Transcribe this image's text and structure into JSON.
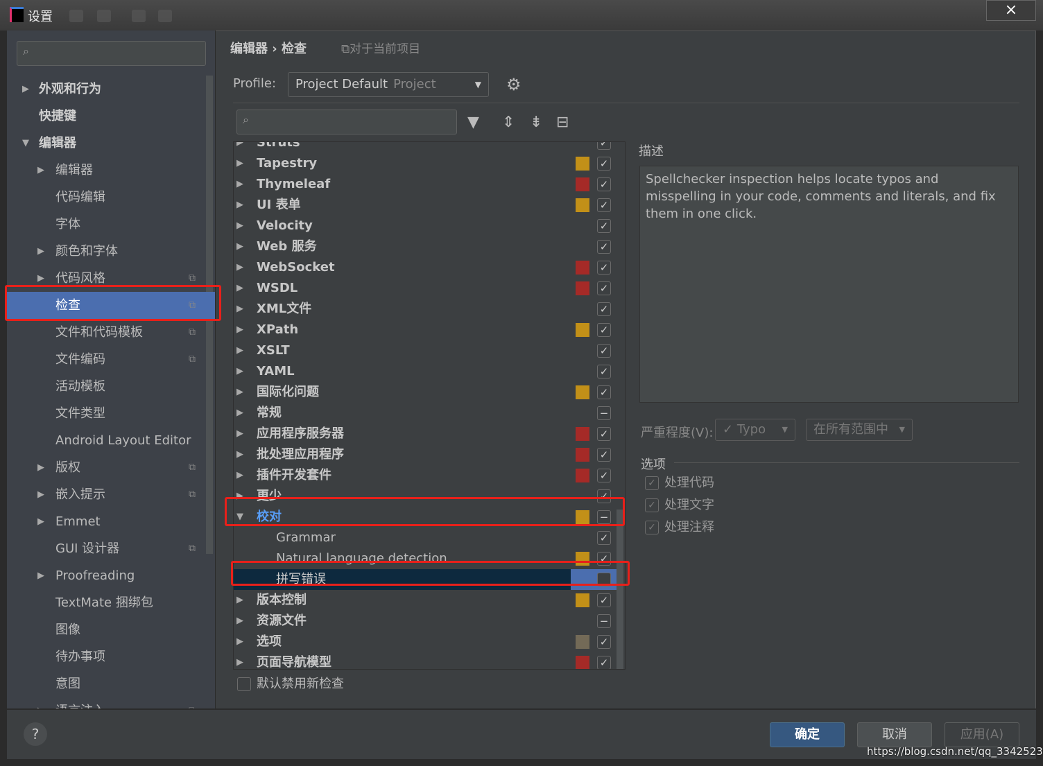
{
  "window": {
    "title": "设置",
    "close_icon": "×"
  },
  "sidebar": {
    "search_placeholder": "",
    "items": [
      {
        "label": "外观和行为",
        "arrow": "▶",
        "level": 0,
        "bold": true
      },
      {
        "label": "快捷键",
        "arrow": "",
        "level": 0,
        "bold": true
      },
      {
        "label": "编辑器",
        "arrow": "▼",
        "level": 0,
        "bold": true
      },
      {
        "label": "编辑器",
        "arrow": "▶",
        "level": 1
      },
      {
        "label": "代码编辑",
        "arrow": "",
        "level": 1
      },
      {
        "label": "字体",
        "arrow": "",
        "level": 1
      },
      {
        "label": "颜色和字体",
        "arrow": "▶",
        "level": 1
      },
      {
        "label": "代码风格",
        "arrow": "▶",
        "level": 1,
        "copy": true
      },
      {
        "label": "检查",
        "arrow": "",
        "level": 1,
        "copy": true,
        "selected": true
      },
      {
        "label": "文件和代码模板",
        "arrow": "",
        "level": 1,
        "copy": true
      },
      {
        "label": "文件编码",
        "arrow": "",
        "level": 1,
        "copy": true
      },
      {
        "label": "活动模板",
        "arrow": "",
        "level": 1
      },
      {
        "label": "文件类型",
        "arrow": "",
        "level": 1
      },
      {
        "label": "Android Layout Editor",
        "arrow": "",
        "level": 1
      },
      {
        "label": "版权",
        "arrow": "▶",
        "level": 1,
        "copy": true
      },
      {
        "label": "嵌入提示",
        "arrow": "▶",
        "level": 1,
        "copy": true
      },
      {
        "label": "Emmet",
        "arrow": "▶",
        "level": 1
      },
      {
        "label": "GUI 设计器",
        "arrow": "",
        "level": 1,
        "copy": true
      },
      {
        "label": "Proofreading",
        "arrow": "▶",
        "level": 1
      },
      {
        "label": "TextMate 捆绑包",
        "arrow": "",
        "level": 1
      },
      {
        "label": "图像",
        "arrow": "",
        "level": 1
      },
      {
        "label": "待办事项",
        "arrow": "",
        "level": 1
      },
      {
        "label": "意图",
        "arrow": "",
        "level": 1
      },
      {
        "label": "语言注入",
        "arrow": "▶",
        "level": 1,
        "copy": true
      }
    ]
  },
  "main": {
    "breadcrumb": "编辑器 › 检查",
    "scope_note": "对于当前项目",
    "profile_label": "Profile:",
    "profile_value": "Project Default",
    "profile_scope": "Project",
    "tree": [
      {
        "label": "Struts",
        "arrow": "▶",
        "sev": "",
        "state": "check"
      },
      {
        "label": "Tapestry",
        "arrow": "▶",
        "sev": "#c29018",
        "state": "check"
      },
      {
        "label": "Thymeleaf",
        "arrow": "▶",
        "sev": "#a52a27",
        "state": "check"
      },
      {
        "label": "UI 表单",
        "arrow": "▶",
        "sev": "#c29018",
        "state": "check"
      },
      {
        "label": "Velocity",
        "arrow": "▶",
        "sev": "",
        "state": "check"
      },
      {
        "label": "Web 服务",
        "arrow": "▶",
        "sev": "",
        "state": "check"
      },
      {
        "label": "WebSocket",
        "arrow": "▶",
        "sev": "#a52a27",
        "state": "check"
      },
      {
        "label": "WSDL",
        "arrow": "▶",
        "sev": "#a52a27",
        "state": "check"
      },
      {
        "label": "XML文件",
        "arrow": "▶",
        "sev": "",
        "state": "check"
      },
      {
        "label": "XPath",
        "arrow": "▶",
        "sev": "#c29018",
        "state": "check"
      },
      {
        "label": "XSLT",
        "arrow": "▶",
        "sev": "",
        "state": "check"
      },
      {
        "label": "YAML",
        "arrow": "▶",
        "sev": "",
        "state": "check"
      },
      {
        "label": "国际化问题",
        "arrow": "▶",
        "sev": "#c29018",
        "state": "check"
      },
      {
        "label": "常规",
        "arrow": "▶",
        "sev": "",
        "state": "partial"
      },
      {
        "label": "应用程序服务器",
        "arrow": "▶",
        "sev": "#a52a27",
        "state": "check"
      },
      {
        "label": "批处理应用程序",
        "arrow": "▶",
        "sev": "#a52a27",
        "state": "check"
      },
      {
        "label": "插件开发套件",
        "arrow": "▶",
        "sev": "#a52a27",
        "state": "check"
      },
      {
        "label": "更少",
        "arrow": "▶",
        "sev": "",
        "state": "check"
      },
      {
        "label": "校对",
        "arrow": "▼",
        "sev": "#c29018",
        "state": "partial",
        "highlight": true
      },
      {
        "label": "Grammar",
        "arrow": "",
        "sev": "",
        "state": "check",
        "child": true
      },
      {
        "label": "Natural language detection",
        "arrow": "",
        "sev": "#c29018",
        "state": "check",
        "child": true
      },
      {
        "label": "拼写错误",
        "arrow": "",
        "sev": "",
        "state": "unchecked",
        "child": true,
        "selected": true
      },
      {
        "label": "版本控制",
        "arrow": "▶",
        "sev": "#c29018",
        "state": "check"
      },
      {
        "label": "资源文件",
        "arrow": "▶",
        "sev": "",
        "state": "partial"
      },
      {
        "label": "选项",
        "arrow": "▶",
        "sev": "#736a57",
        "state": "check"
      },
      {
        "label": "页面导航模型",
        "arrow": "▶",
        "sev": "#a52a27",
        "state": "check"
      }
    ],
    "disable_new_label": "默认禁用新检查",
    "description_label": "描述",
    "description": "Spellchecker inspection helps locate typos and misspelling in your code, comments and literals, and fix them in one click.",
    "severity_label": "严重程度(V):",
    "severity_value": "Typo",
    "scope_value": "在所有范围中",
    "options_label": "选项",
    "options": [
      {
        "label": "处理代码",
        "checked": true
      },
      {
        "label": "处理文字",
        "checked": true
      },
      {
        "label": "处理注释",
        "checked": true
      }
    ]
  },
  "footer": {
    "help": "?",
    "ok": "确定",
    "cancel": "取消",
    "apply": "应用(A)"
  },
  "watermark": "https://blog.csdn.net/qq_33425234",
  "colors": {
    "selection": "#4b6eaf",
    "tree_selection": "#0d293e",
    "annotation": "#e8201a",
    "ok_button": "#365880"
  }
}
